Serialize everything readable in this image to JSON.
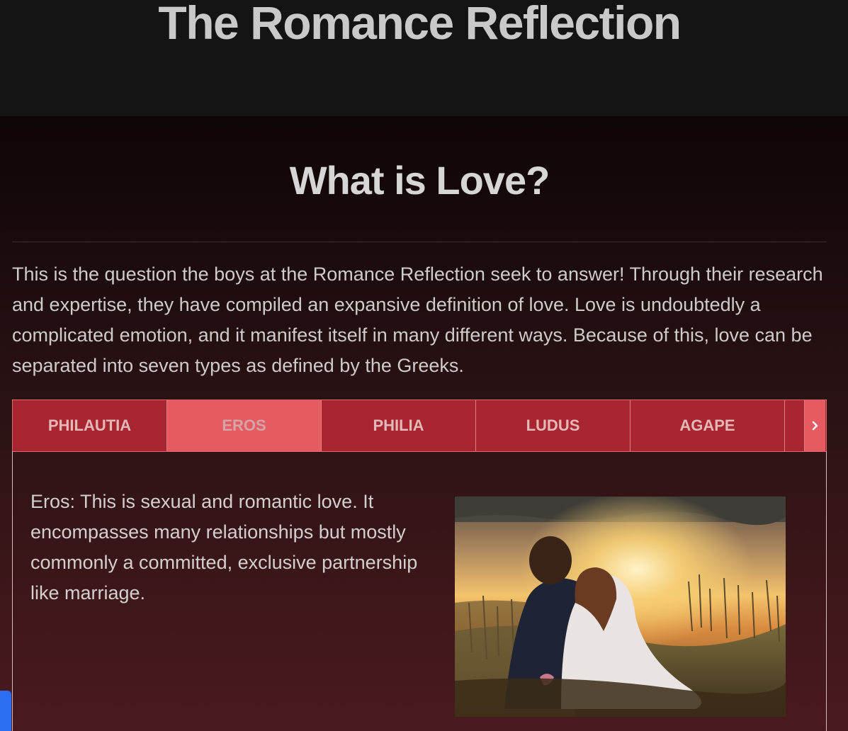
{
  "header": {
    "site_title": "The Romance Reflection"
  },
  "main": {
    "heading": "What is Love?",
    "intro": "This is the question the boys at the Romance Reflection seek to answer! Through their research and expertise, they have compiled an expansive definition of love. Love is undoubtedly a complicated emotion, and it manifest itself in many different ways. Because of this, love can be separated into seven types as defined by the Greeks."
  },
  "tabs": {
    "items": [
      {
        "label": "PHILAUTIA"
      },
      {
        "label": "EROS"
      },
      {
        "label": "PHILIA"
      },
      {
        "label": "LUDUS"
      },
      {
        "label": "AGAPE"
      }
    ],
    "active_index": 1,
    "next_icon": "chevron-right-icon"
  },
  "panel": {
    "text": "Eros: This is sexual and romantic love. It encompasses many relationships but mostly commonly a committed, exclusive partnership like marriage.",
    "image_subject": "couple sitting by a lake at sunset"
  },
  "colors": {
    "header_bg": "#141414",
    "tab_bg": "#a8262f",
    "tab_active_bg": "#e55b61",
    "side_tab": "#2c6ef2"
  }
}
